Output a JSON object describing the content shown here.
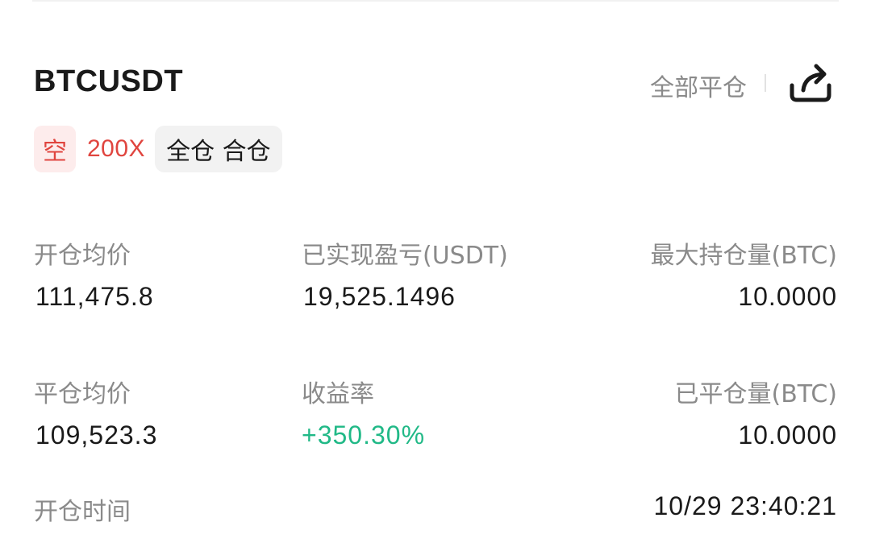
{
  "position": {
    "symbol": "BTCUSDT",
    "close_all_label": "全部平仓",
    "share_icon": "share-icon",
    "side_label": "空",
    "leverage": "200X",
    "margin_mode": "全仓 合仓"
  },
  "stats": {
    "avg_open_price": {
      "label": "开仓均价",
      "value": "111,475.8"
    },
    "realized_pnl": {
      "label": "已实现盈亏(USDT)",
      "value": "19,525.1496"
    },
    "max_position": {
      "label": "最大持仓量(BTC)",
      "value": "10.0000"
    },
    "avg_close_price": {
      "label": "平仓均价",
      "value": "109,523.3"
    },
    "roi": {
      "label": "收益率",
      "value": "+350.30%"
    },
    "closed_amount": {
      "label": "已平仓量(BTC)",
      "value": "10.0000"
    },
    "open_time": {
      "label": "开仓时间",
      "value": "10/29 23:40:21"
    }
  },
  "colors": {
    "short_red": "#e0453f",
    "short_bg": "#fdecec",
    "profit_green": "#21b987",
    "label_gray": "#8a8a8a"
  }
}
